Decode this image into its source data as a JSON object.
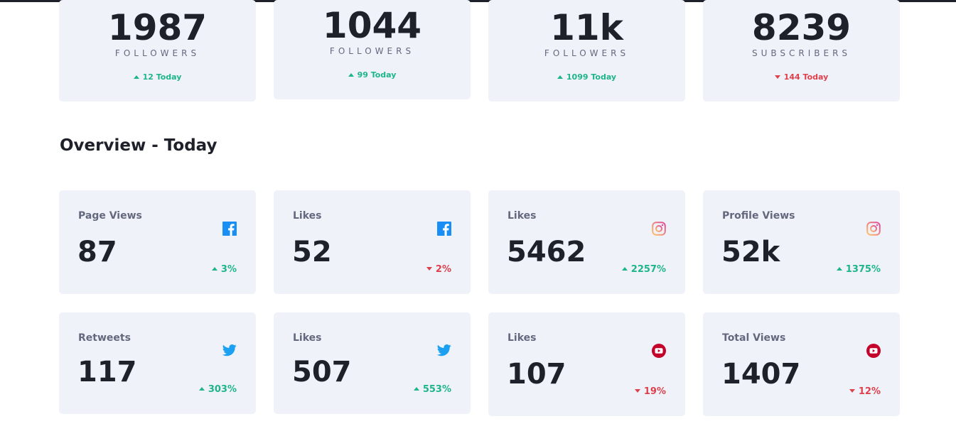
{
  "summary_cards": [
    {
      "count": "1987",
      "unit": "FOLLOWERS",
      "today": "12 Today",
      "trend": "up"
    },
    {
      "count": "1044",
      "unit": "FOLLOWERS",
      "today": "99 Today",
      "trend": "up"
    },
    {
      "count": "11k",
      "unit": "FOLLOWERS",
      "today": "1099 Today",
      "trend": "up"
    },
    {
      "count": "8239",
      "unit": "SUBSCRIBERS",
      "today": "144 Today",
      "trend": "down"
    }
  ],
  "overview": {
    "title": "Overview - Today",
    "cards": [
      {
        "metric": "Page Views",
        "value": "87",
        "change": "3%",
        "trend": "up",
        "icon": "facebook-icon"
      },
      {
        "metric": "Likes",
        "value": "52",
        "change": "2%",
        "trend": "down",
        "icon": "facebook-icon"
      },
      {
        "metric": "Likes",
        "value": "5462",
        "change": "2257%",
        "trend": "up",
        "icon": "instagram-icon"
      },
      {
        "metric": "Profile Views",
        "value": "52k",
        "change": "1375%",
        "trend": "up",
        "icon": "instagram-icon"
      },
      {
        "metric": "Retweets",
        "value": "117",
        "change": "303%",
        "trend": "up",
        "icon": "twitter-icon"
      },
      {
        "metric": "Likes",
        "value": "507",
        "change": "553%",
        "trend": "up",
        "icon": "twitter-icon"
      },
      {
        "metric": "Likes",
        "value": "107",
        "change": "19%",
        "trend": "down",
        "icon": "youtube-icon"
      },
      {
        "metric": "Total Views",
        "value": "1407",
        "change": "12%",
        "trend": "down",
        "icon": "youtube-icon"
      }
    ]
  },
  "colors": {
    "card_bg": "#f0f2fa",
    "up": "#1eb589",
    "down": "#dc414c",
    "facebook": "#198ff5",
    "twitter": "#1ca0f2",
    "youtube": "#c4032a",
    "instagram": "#e8804f"
  }
}
